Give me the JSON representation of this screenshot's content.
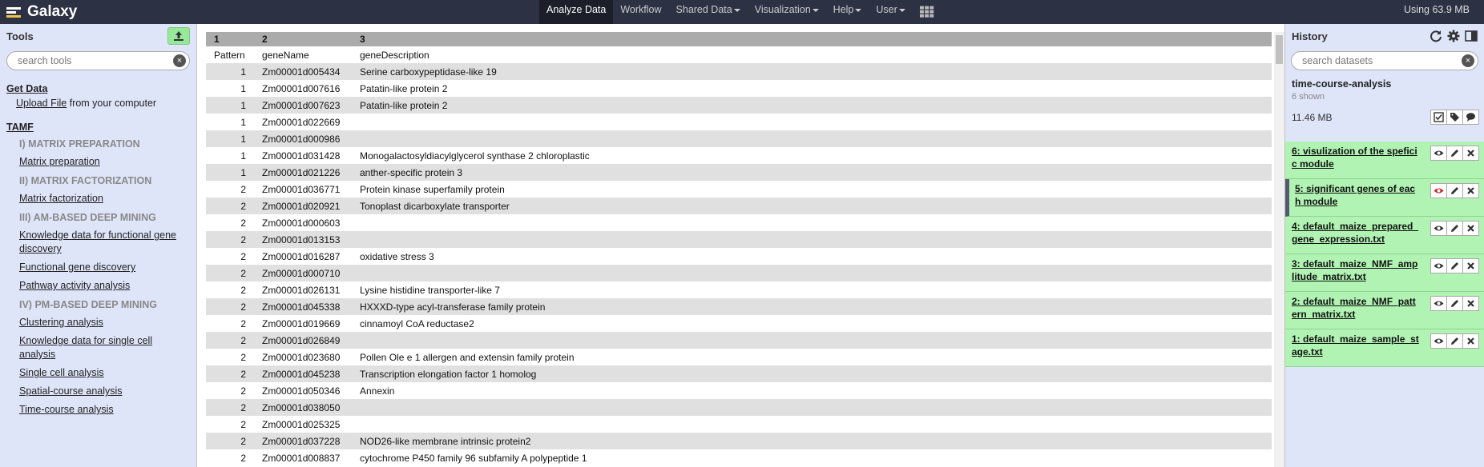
{
  "masthead": {
    "brand": "Galaxy",
    "nav": [
      {
        "label": "Analyze Data",
        "active": true,
        "dropdown": false
      },
      {
        "label": "Workflow",
        "active": false,
        "dropdown": false
      },
      {
        "label": "Shared Data",
        "active": false,
        "dropdown": true
      },
      {
        "label": "Visualization",
        "active": false,
        "dropdown": true
      },
      {
        "label": "Help",
        "active": false,
        "dropdown": true
      },
      {
        "label": "User",
        "active": false,
        "dropdown": true
      }
    ],
    "quota": "Using 63.9 MB"
  },
  "tools_panel": {
    "title": "Tools",
    "search_placeholder": "search tools",
    "get_data": "Get Data",
    "upload_link": "Upload File",
    "upload_suffix": " from your computer",
    "tamf": "TAMF",
    "items": [
      {
        "type": "label",
        "text": "I) MATRIX PREPARATION"
      },
      {
        "type": "tool",
        "text": "Matrix preparation"
      },
      {
        "type": "label",
        "text": "II) MATRIX FACTORIZATION"
      },
      {
        "type": "tool",
        "text": "Matrix factorization"
      },
      {
        "type": "label",
        "text": "III) AM-BASED DEEP MINING"
      },
      {
        "type": "tool",
        "text": "Knowledge data for functional gene discovery"
      },
      {
        "type": "tool",
        "text": "Functional gene discovery"
      },
      {
        "type": "tool",
        "text": "Pathway activity analysis"
      },
      {
        "type": "label",
        "text": "IV) PM-BASED DEEP MINING"
      },
      {
        "type": "tool",
        "text": "Clustering analysis"
      },
      {
        "type": "tool",
        "text": "Knowledge data for single cell analysis"
      },
      {
        "type": "tool",
        "text": "Single cell analysis"
      },
      {
        "type": "tool",
        "text": "Spatial-course analysis"
      },
      {
        "type": "tool",
        "text": "Time-course analysis"
      }
    ]
  },
  "dataset_view": {
    "column_numbers": [
      "1",
      "2",
      "3"
    ],
    "column_names": [
      "Pattern",
      "geneName",
      "geneDescription"
    ],
    "rows": [
      [
        "1",
        "Zm00001d005434",
        "Serine carboxypeptidase-like 19"
      ],
      [
        "1",
        "Zm00001d007616",
        "Patatin-like protein 2"
      ],
      [
        "1",
        "Zm00001d007623",
        "Patatin-like protein 2"
      ],
      [
        "1",
        "Zm00001d022669",
        ""
      ],
      [
        "1",
        "Zm00001d000986",
        ""
      ],
      [
        "1",
        "Zm00001d031428",
        "Monogalactosyldiacylglycerol synthase 2 chloroplastic"
      ],
      [
        "1",
        "Zm00001d021226",
        "anther-specific protein 3"
      ],
      [
        "2",
        "Zm00001d036771",
        "Protein kinase superfamily protein"
      ],
      [
        "2",
        "Zm00001d020921",
        "Tonoplast dicarboxylate transporter"
      ],
      [
        "2",
        "Zm00001d000603",
        ""
      ],
      [
        "2",
        "Zm00001d013153",
        ""
      ],
      [
        "2",
        "Zm00001d016287",
        "oxidative stress 3"
      ],
      [
        "2",
        "Zm00001d000710",
        ""
      ],
      [
        "2",
        "Zm00001d026131",
        "Lysine histidine transporter-like 7"
      ],
      [
        "2",
        "Zm00001d045338",
        "HXXXD-type acyl-transferase family protein"
      ],
      [
        "2",
        "Zm00001d019669",
        "cinnamoyl CoA reductase2"
      ],
      [
        "2",
        "Zm00001d026849",
        ""
      ],
      [
        "2",
        "Zm00001d023680",
        "Pollen Ole e 1 allergen and extensin family protein"
      ],
      [
        "2",
        "Zm00001d045238",
        "Transcription elongation factor 1 homolog"
      ],
      [
        "2",
        "Zm00001d050346",
        "Annexin"
      ],
      [
        "2",
        "Zm00001d038050",
        ""
      ],
      [
        "2",
        "Zm00001d025325",
        ""
      ],
      [
        "2",
        "Zm00001d037228",
        "NOD26-like membrane intrinsic protein2"
      ],
      [
        "2",
        "Zm00001d008837",
        "cytochrome P450 family 96 subfamily A polypeptide 1"
      ]
    ]
  },
  "history_panel": {
    "title": "History",
    "search_placeholder": "search datasets",
    "name": "time-course-analysis",
    "shown": "6 shown",
    "size": "11.46 MB",
    "datasets": [
      {
        "title": "6: visulization of the speficic module",
        "current": false,
        "eye_color": "#333333"
      },
      {
        "title": "5: significant genes of each module",
        "current": true,
        "eye_color": "#cc2222"
      },
      {
        "title": "4: default_maize_prepared_gene_expression.txt",
        "current": false,
        "eye_color": "#333333"
      },
      {
        "title": "3: default_maize_NMF_amplitude_matrix.txt",
        "current": false,
        "eye_color": "#333333"
      },
      {
        "title": "2: default_maize_NMF_pattern_matrix.txt",
        "current": false,
        "eye_color": "#333333"
      },
      {
        "title": "1: default_maize_sample_stage.txt",
        "current": false,
        "eye_color": "#333333"
      }
    ]
  }
}
